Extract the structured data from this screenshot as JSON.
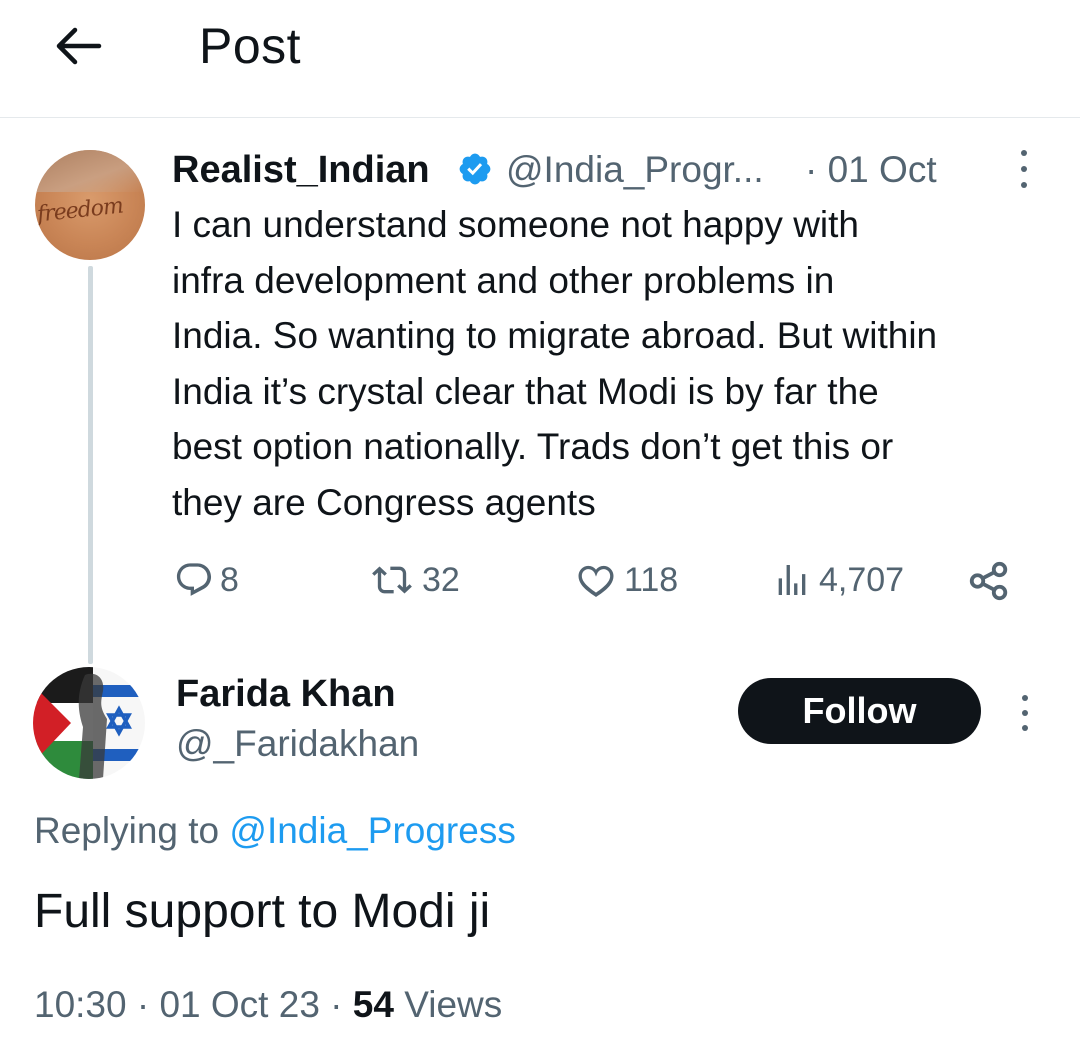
{
  "header": {
    "title": "Post"
  },
  "parent_tweet": {
    "name": "Realist_Indian",
    "handle": "@India_Progr...",
    "date": "· 01 Oct",
    "avatar_text": "freedom",
    "text": "I can understand someone not happy with\ninfra development and other problems in\nIndia. So wanting to migrate abroad. But within\nIndia it’s crystal clear that Modi is by far the\nbest option nationally. Trads don’t get this or\nthey are Congress agents",
    "replies": "8",
    "reposts": "32",
    "likes": "118",
    "views": "4,707"
  },
  "reply": {
    "name": "Farida Khan",
    "handle": "@_Faridakhan",
    "follow_label": "Follow",
    "replying_prefix": "Replying to ",
    "replying_to": "@India_Progress",
    "text": "Full support to Modi ji",
    "timestamp": "10:30 · 01 Oct 23 · ",
    "views_count": "54",
    "views_label": " Views"
  },
  "colors": {
    "accent": "#1d9bf0",
    "text": "#0f1419",
    "muted": "#536471",
    "button": "#0f1419"
  }
}
